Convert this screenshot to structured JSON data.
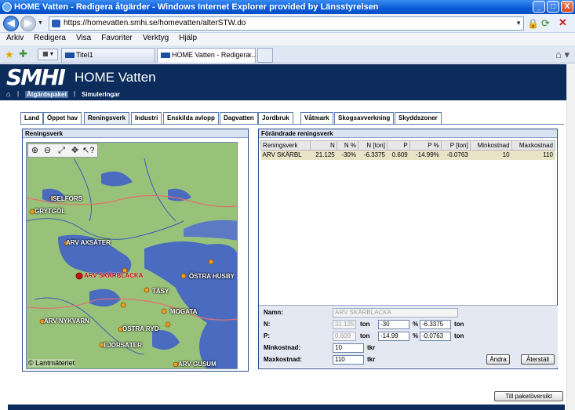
{
  "window": {
    "title": "HOME Vatten - Redigera åtgärder - Windows Internet Explorer provided by Länsstyrelsen",
    "btn_minimize": "_",
    "btn_maximize": "□",
    "btn_close": "X"
  },
  "browser": {
    "url": "https://homevatten.smhi.se/homevatten/alterSTW.do",
    "menu": [
      "Arkiv",
      "Redigera",
      "Visa",
      "Favoriter",
      "Verktyg",
      "Hjälp"
    ],
    "tabs": [
      {
        "label": "Titel1"
      },
      {
        "label": "HOME Vatten - Redigera ..."
      }
    ],
    "tab_close": "x"
  },
  "site": {
    "logo": "SMHI",
    "title": "HOME Vatten",
    "subnav": [
      "Åtgärdspaket",
      "Simuleringar"
    ],
    "sep": "|"
  },
  "categories": [
    "Land",
    "Öppet hav",
    "Reningsverk",
    "Industri",
    "Enskilda avlopp",
    "Dagvatten",
    "Jordbruk",
    "Våtmark",
    "Skogsavverkning",
    "Skyddszoner"
  ],
  "map_panel": {
    "title": "Reningsverk",
    "copyright": "© Lantmäteriet",
    "places": [
      "ISELFORS",
      "GRYTGÖL",
      "ARV AXSÄTER",
      "ARV SKÄRBLACKA",
      "ÖSTRA HUSBY",
      "TÅSY",
      "MOGATA",
      "ARV NYKVARN",
      "ÖSTRA RYD",
      "EJORSÄTER",
      "ARV GUSUM"
    ]
  },
  "changed_panel": {
    "title": "Förändrade reningsverk",
    "columns": [
      "Reningsverk",
      "N",
      "N %",
      "N [ton]",
      "P",
      "P %",
      "P [ton]",
      "Minkostnad",
      "Maxkostnad"
    ],
    "rows": [
      [
        "ARV SKÄRBL",
        "21.125",
        "-30%",
        "-6.3375",
        "0.609",
        "-14.99%",
        "-0.0763",
        "10",
        "110"
      ]
    ]
  },
  "form": {
    "name_label": "Namn:",
    "name_value": "ARV SKÄRBLACKA",
    "n_label": "N:",
    "n_value": "21.125",
    "n_pct": "-30",
    "n_ton": "-6.3375",
    "p_label": "P:",
    "p_value": "0.609",
    "p_pct": "-14.99",
    "p_ton": "-0.0763",
    "unit_ton": "ton",
    "unit_pct": "%",
    "unit_tkr": "tkr",
    "min_label": "Minkostnad:",
    "min_value": "10",
    "max_label": "Maxkostnad:",
    "max_value": "110",
    "change_btn": "Ändra",
    "reset_btn": "Återställ"
  },
  "overview_btn": "Till paketöversikt"
}
